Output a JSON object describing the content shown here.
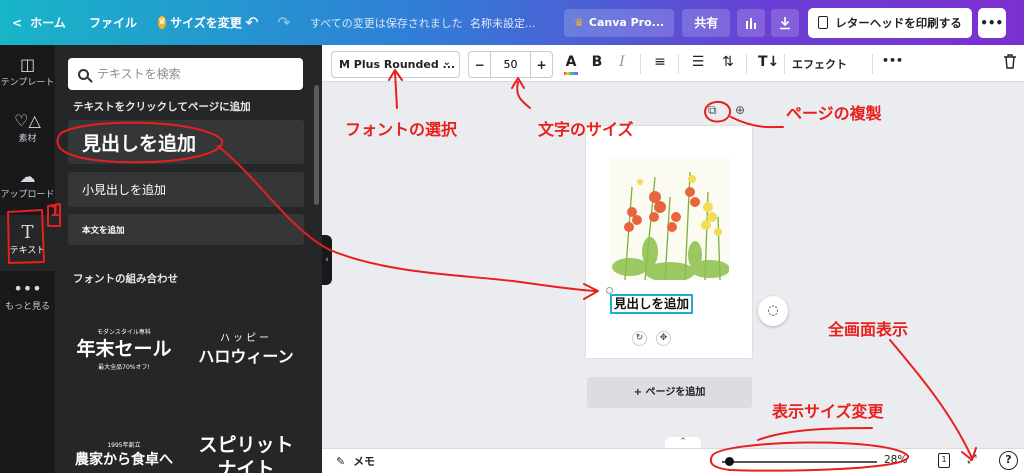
{
  "topbar": {
    "home": "ホーム",
    "file": "ファイル",
    "resize": "サイズを変更",
    "saved_status": "すべての変更は保存されました",
    "doc_name": "名称未設定...",
    "pro": "Canva Pro...",
    "share": "共有",
    "print": "レターヘッドを印刷する",
    "more": "•••"
  },
  "rail": {
    "items": [
      {
        "label": "テンプレート",
        "icon": "template-icon"
      },
      {
        "label": "素材",
        "icon": "elements-icon"
      },
      {
        "label": "アップロード",
        "icon": "upload-icon"
      },
      {
        "label": "テキスト",
        "icon": "text-icon"
      },
      {
        "label": "もっと見る",
        "icon": "more-icon"
      }
    ]
  },
  "panel": {
    "search_placeholder": "テキストを検索",
    "click_hint": "テキストをクリックしてページに追加",
    "add_heading": "見出しを追加",
    "add_subheading": "小見出しを追加",
    "add_body": "本文を追加",
    "font_combos_title": "フォントの組み合わせ",
    "combos": [
      {
        "small": "モダンスタイル専科",
        "big": "年末セール",
        "sub": "最大全品70%オフ!"
      },
      {
        "small": "ハッピー",
        "big": "ハロウィーン",
        "sub": ""
      },
      {
        "small": "1995年創立",
        "big": "農家から食卓へ",
        "sub": ""
      },
      {
        "small": "",
        "big": "スピリット",
        "sub": "ナイト"
      }
    ]
  },
  "toolbar": {
    "font": "M Plus Rounded ...",
    "font_size": "50",
    "minus": "−",
    "plus": "+",
    "effect": "エフェクト",
    "more": "•••"
  },
  "canvas": {
    "heading_text": "見出しを追加",
    "add_page": "+ ページを追加"
  },
  "bottombar": {
    "memo": "メモ",
    "zoom": "28%",
    "page_count": "1",
    "help": "?",
    "zoom_level": 0.28
  },
  "annotations": {
    "font_select": "フォントの選択",
    "font_size": "文字のサイズ",
    "page_duplicate": "ページの複製",
    "fullscreen": "全画面表示",
    "zoom_change": "表示サイズ変更",
    "step": "1"
  },
  "colors": {
    "annotation_red": "#e8201d",
    "selection_cyan": "#19b3c9",
    "panel_dark": "#252627"
  }
}
